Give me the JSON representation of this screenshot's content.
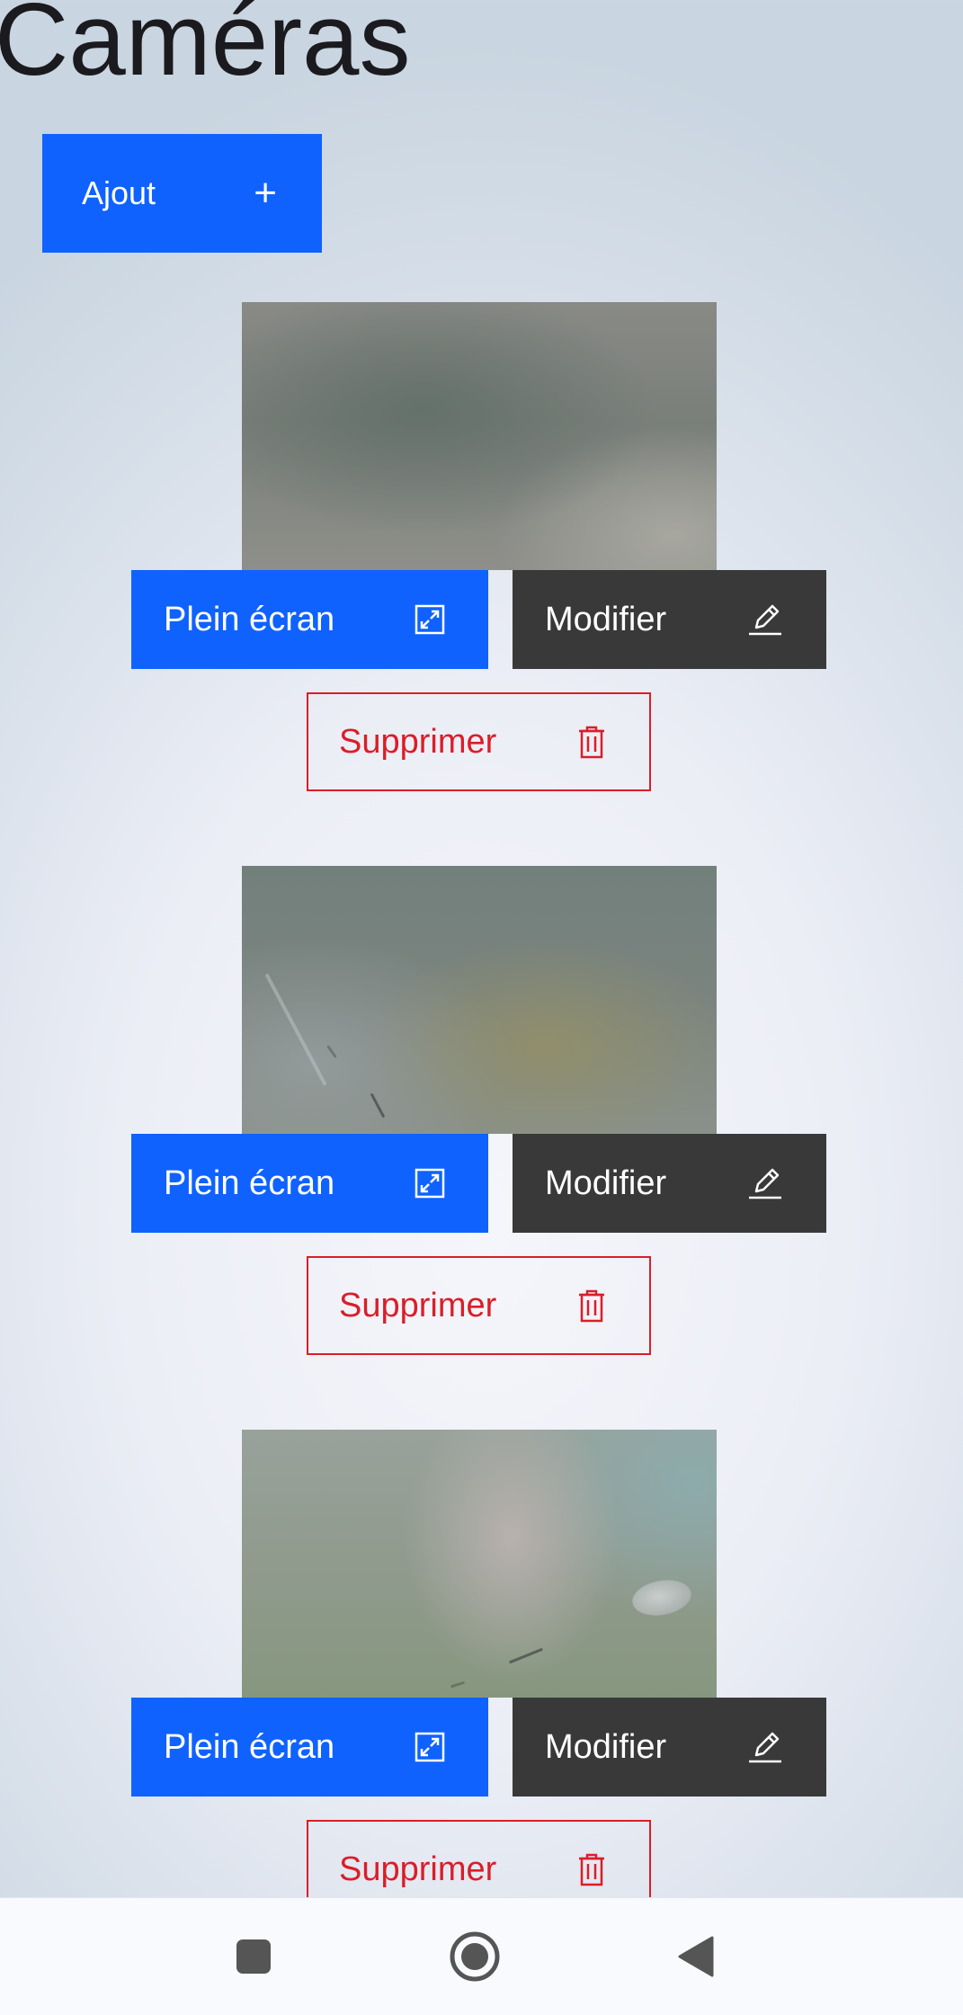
{
  "page": {
    "title": "Caméras"
  },
  "toolbar": {
    "add_label": "Ajout",
    "add_icon": "plus-icon"
  },
  "cameras": [
    {
      "fullscreen_label": "Plein écran",
      "edit_label": "Modifier",
      "delete_label": "Supprimer"
    },
    {
      "fullscreen_label": "Plein écran",
      "edit_label": "Modifier",
      "delete_label": "Supprimer"
    },
    {
      "fullscreen_label": "Plein écran",
      "edit_label": "Modifier",
      "delete_label": "Supprimer"
    }
  ],
  "icons": {
    "fullscreen": "fullscreen-icon",
    "edit": "pencil-icon",
    "delete": "trash-icon"
  },
  "colors": {
    "primary": "#0f62fe",
    "secondary": "#393939",
    "danger": "#da1e28",
    "title_text": "#1b1b1f"
  },
  "nav_bar": {
    "items": [
      "recents-square-icon",
      "home-circle-icon",
      "back-triangle-icon"
    ]
  }
}
